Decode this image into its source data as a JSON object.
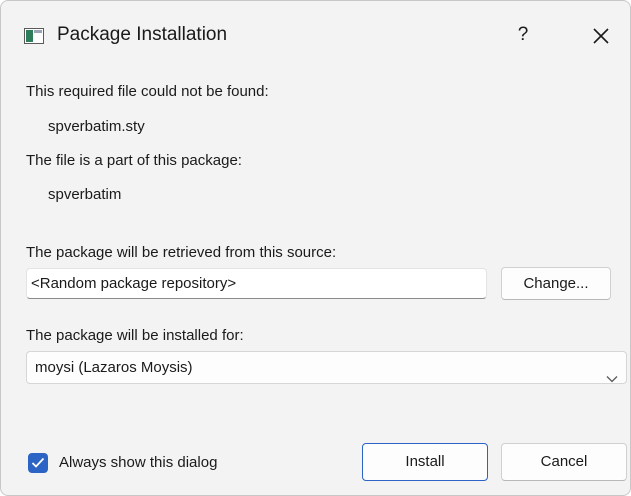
{
  "window": {
    "title": "Package Installation",
    "help_label": "?",
    "icon": "package-window-icon",
    "close_icon": "close-icon"
  },
  "file": {
    "missing_label": "This required file could not be found:",
    "missing_value": "spverbatim.sty",
    "package_label": "The file is a part of this package:",
    "package_value": "spverbatim"
  },
  "source": {
    "label": "The package will be retrieved from this source:",
    "value": "<Random package repository>",
    "change_label": "Change..."
  },
  "target": {
    "label": "The package will be installed for:",
    "selected": "moysi (Lazaros Moysis)"
  },
  "footer": {
    "always_show_label": "Always show this dialog",
    "always_show_checked": true,
    "install_label": "Install",
    "cancel_label": "Cancel"
  },
  "colors": {
    "accent": "#2b64c4",
    "dialog_bg": "#f3f3f3"
  }
}
